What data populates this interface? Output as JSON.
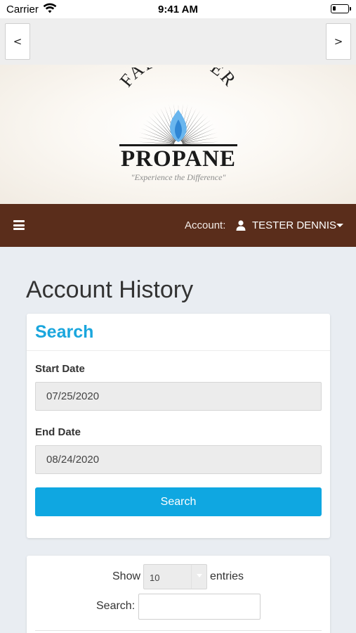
{
  "status_bar": {
    "carrier": "Carrier",
    "time": "9:41 AM"
  },
  "browser_nav": {
    "back_label": "<",
    "forward_label": ">"
  },
  "logo": {
    "top_text": "FALL RIVER",
    "main_text": "PROPANE",
    "tagline": "\"Experience the Difference\""
  },
  "menu": {
    "account_label": "Account:",
    "account_name": "TESTER DENNIS"
  },
  "page": {
    "title": "Account History"
  },
  "search_card": {
    "title": "Search",
    "start_date_label": "Start Date",
    "start_date_value": "07/25/2020",
    "end_date_label": "End Date",
    "end_date_value": "08/24/2020",
    "search_button": "Search"
  },
  "table_controls": {
    "show_label": "Show",
    "entries_value": "10",
    "entries_label": "entries",
    "search_label": "Search:"
  },
  "colors": {
    "menu_bar": "#5a2d1b",
    "accent": "#1aa6dd",
    "button": "#0fa7e1",
    "page_bg": "#e9edf2"
  },
  "icons": [
    "wifi-icon",
    "battery-icon",
    "hamburger-icon",
    "user-icon",
    "caret-down-icon",
    "flame-icon"
  ]
}
